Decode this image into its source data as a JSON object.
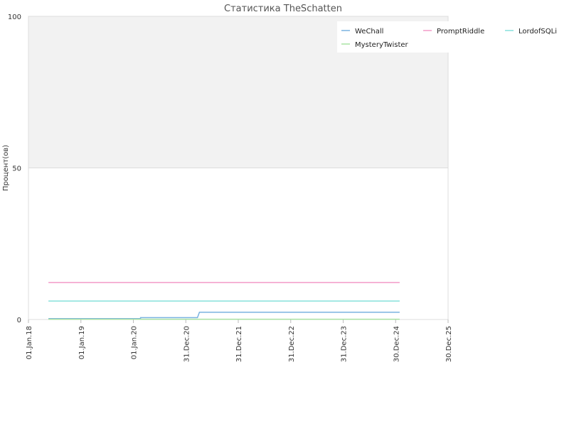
{
  "chart_data": {
    "type": "line",
    "title": "Статистика TheSchatten",
    "ylabel": "Процент(ов)",
    "xlabel": "",
    "ylim": [
      0,
      100
    ],
    "y_ticks": [
      0,
      50,
      100
    ],
    "y_tick_labels": [
      "0",
      "50",
      "100"
    ],
    "x_range": [
      "2018-01-01",
      "2025-12-30"
    ],
    "x_ticks": [
      "2018-01-01",
      "2019-01-01",
      "2020-01-01",
      "2020-12-31",
      "2021-12-31",
      "2022-12-31",
      "2023-12-31",
      "2024-12-30",
      "2025-12-30"
    ],
    "x_tick_labels": [
      "01.Jan.18",
      "01.Jan.19",
      "01.Jan.20",
      "31.Dec.20",
      "31.Dec.21",
      "31.Dec.22",
      "31.Dec.23",
      "30.Dec.24",
      "30.Dec.25"
    ],
    "grid": true,
    "background_bands": [
      {
        "from": 50,
        "to": 100,
        "color": "#f2f2f2"
      }
    ],
    "legend_position": "top-right",
    "series": [
      {
        "name": "WeChall",
        "color": "#7ab3e0",
        "points": [
          [
            "2018-05-20",
            0.3
          ],
          [
            "2020-02-20",
            0.3
          ],
          [
            "2020-02-20",
            0.6
          ],
          [
            "2021-03-22",
            0.6
          ],
          [
            "2021-04-05",
            2.4
          ],
          [
            "2025-01-27",
            2.4
          ]
        ]
      },
      {
        "name": "PromptRiddle",
        "color": "#f29ac8",
        "points": [
          [
            "2018-05-20",
            12.2
          ],
          [
            "2025-01-27",
            12.2
          ]
        ]
      },
      {
        "name": "LordofSQLi",
        "color": "#86e0dc",
        "points": [
          [
            "2018-05-20",
            6.1
          ],
          [
            "2025-01-27",
            6.1
          ]
        ]
      },
      {
        "name": "MysteryTwister",
        "color": "#a9e3a3",
        "points": [
          [
            "2018-05-20",
            0.1
          ],
          [
            "2025-01-27",
            0.1
          ]
        ]
      }
    ]
  }
}
